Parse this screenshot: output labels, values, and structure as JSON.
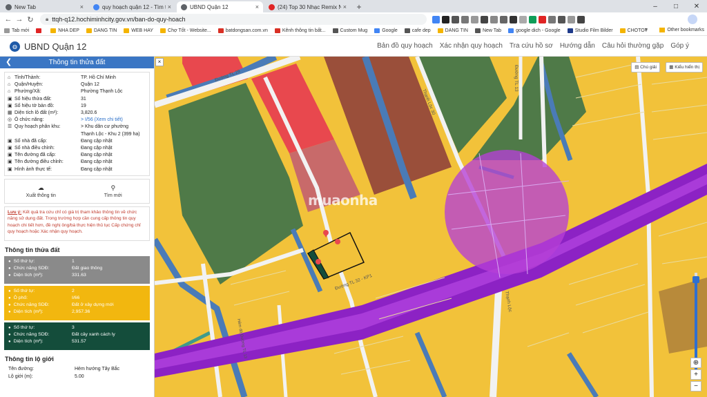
{
  "browser": {
    "tabs": [
      {
        "title": "New Tab",
        "active": false,
        "color": "#5f6368"
      },
      {
        "title": "quy hoạch quận 12 - Tìm trên G",
        "active": false,
        "color": "#4285f4"
      },
      {
        "title": "UBND Quận 12",
        "active": true,
        "color": "#5f6368"
      },
      {
        "title": "(24) Top 30 Nhạc Remix Ngh",
        "active": false,
        "color": "#e02424"
      }
    ],
    "url": "ttqh-q12.hochiminhcity.gov.vn/ban-do-quy-hoach",
    "bookmarks": [
      {
        "label": "Tab mới",
        "color": "#999"
      },
      {
        "label": "",
        "color": "#e02424"
      },
      {
        "label": "NHA DEP",
        "color": "#f4b400"
      },
      {
        "label": "DANG TIN",
        "color": "#f4b400"
      },
      {
        "label": "WEB HAY",
        "color": "#f4b400"
      },
      {
        "label": "Chợ Tốt - Website...",
        "color": "#f4b400"
      },
      {
        "label": "batdongsan.com.vn",
        "color": "#d93025"
      },
      {
        "label": "Kênh thông tin bất...",
        "color": "#d93025"
      },
      {
        "label": "Custom Mug",
        "color": "#555"
      },
      {
        "label": "Google",
        "color": "#4285f4"
      },
      {
        "label": "cafe dep",
        "color": "#555"
      },
      {
        "label": "DANG TIN",
        "color": "#f4b400"
      },
      {
        "label": "New Tab",
        "color": "#555"
      },
      {
        "label": "google dich - Google",
        "color": "#4285f4"
      },
      {
        "label": "Studio Film Bilder",
        "color": "#1e3a8a"
      },
      {
        "label": "CHOTOT",
        "color": "#f4b400"
      }
    ],
    "bookmarks_more": "»",
    "other_bookmarks": "Other bookmarks"
  },
  "site": {
    "title": "UBND Quận 12",
    "nav": [
      "Bản đồ quy hoạch",
      "Xác nhận quy hoạch",
      "Tra cứu hồ sơ",
      "Hướng dẫn",
      "Câu hỏi thường gặp",
      "Góp ý"
    ]
  },
  "panel": {
    "title": "Thông tin thửa đất",
    "info": [
      {
        "icon": "⌂",
        "label": "Tỉnh/Thành:",
        "value": "TP. Hồ Chí Minh",
        "link": false
      },
      {
        "icon": "⌂",
        "label": "Quận/Huyện:",
        "value": "Quận 12",
        "link": false
      },
      {
        "icon": "⌂",
        "label": "Phường/Xã:",
        "value": "Phường Thạnh Lộc",
        "link": false
      },
      {
        "icon": "▣",
        "label": "Số hiệu thửa đất:",
        "value": "31",
        "link": false
      },
      {
        "icon": "▣",
        "label": "Số hiệu tờ bản đồ:",
        "value": "19",
        "link": false
      },
      {
        "icon": "▦",
        "label": "Diện tích lô đất (m²):",
        "value": "3,820.6",
        "link": false
      },
      {
        "icon": "◎",
        "label": "Ô chức năng:",
        "value": ">   I/56 (Xem chi tiết)",
        "link": true
      },
      {
        "icon": "☰",
        "label": "Quy hoạch phân khu:",
        "value": ">   Khu dân cư phường",
        "link": false
      },
      {
        "icon": "",
        "label": "",
        "value": "Thạnh Lộc - Khu 2 (399 ha)",
        "link": false
      },
      {
        "icon": "▣",
        "label": "Số nhà đã cấp:",
        "value": "Đang cập nhật",
        "link": false
      },
      {
        "icon": "▣",
        "label": "Số nhà điều chỉnh:",
        "value": "Đang cập nhật",
        "link": false
      },
      {
        "icon": "▣",
        "label": "Tên đường đã cấp:",
        "value": "Đang cập nhật",
        "link": false
      },
      {
        "icon": "▣",
        "label": "Tên đường điều chỉnh:",
        "value": "Đang cập nhật",
        "link": false
      },
      {
        "icon": "▣",
        "label": "Hình ảnh thực tế:",
        "value": "Đang cập nhật",
        "link": false
      }
    ],
    "actions": [
      {
        "icon": "☁",
        "label": "Xuất thông tin"
      },
      {
        "icon": "⚲",
        "label": "Tìm mới"
      }
    ],
    "note_title": "Lưu ý:",
    "note_text": " Kết quả tra cứu chỉ có giá trị tham khảo thông tin về chức năng sử dụng đất. Trong trường hợp cần cung cấp thông tin quy hoạch chi tiết hơn, đề nghị ông/bà thực hiện thủ tục Cấp chứng chỉ quy hoạch hoặc Xác nhận quy hoạch.",
    "parcel_section_title": "Thông tin thửa đất",
    "parcels": [
      {
        "color": "gray",
        "rows": [
          [
            "Số thứ tự:",
            "1"
          ],
          [
            "Chức năng SDĐ:",
            "Đất giao thông"
          ],
          [
            "Diện tích (m²):",
            "331.63"
          ]
        ]
      },
      {
        "color": "orange",
        "rows": [
          [
            "Số thứ tự:",
            "2"
          ],
          [
            "Ô phố:",
            "I/66"
          ],
          [
            "Chức năng SDĐ:",
            "Đất ở xây dựng mới"
          ],
          [
            "Diện tích (m²):",
            "2,957.36"
          ]
        ]
      },
      {
        "color": "green",
        "rows": [
          [
            "Số thứ tự:",
            "3"
          ],
          [
            "Chức năng SDĐ:",
            "Đất cây xanh cách ly"
          ],
          [
            "Diện tích (m²):",
            "531.57"
          ]
        ]
      }
    ],
    "boundary_section_title": "Thông tin lộ giới",
    "boundary": [
      {
        "label": "Tên đường:",
        "value": "Hẻm hướng Tây Bắc"
      },
      {
        "label": "Lộ giới (m):",
        "value": "5.00"
      }
    ]
  },
  "map": {
    "close_label": "×",
    "legend_button": "Chú giải",
    "display_button": "Kiểu hiển thị",
    "zoom_in": "+",
    "zoom_out": "−",
    "locate": "⊕",
    "zoom_level": 0.93,
    "watermark": "muaonha",
    "street_labels": [
      "Đường TL 29",
      "Thạnh Lộc 30",
      "Đường TL 13",
      "Đường TL 32 - KP1",
      "Thạnh Lộc",
      "Hẻm đá Đường TL 13"
    ],
    "colors": {
      "residential": "#f2c23a",
      "green": "#4f7a48",
      "red": "#e8484e",
      "brown": "#9a4f3a",
      "road": "#f2f2f2",
      "water": "#4a7bb7",
      "metro": "#8c22c4",
      "station": "#b63fd6",
      "teal": "#3f9b8b"
    }
  }
}
